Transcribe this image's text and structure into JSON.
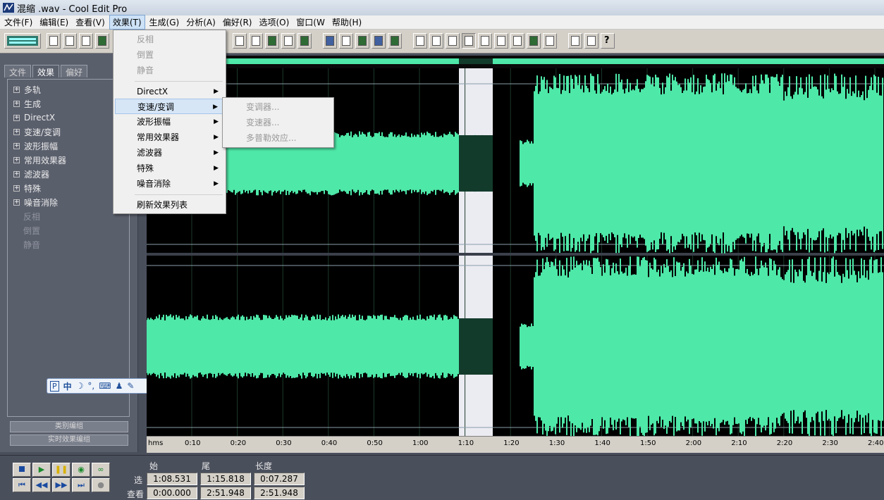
{
  "titlebar": {
    "title": "混缩  .wav - Cool Edit Pro"
  },
  "menubar": [
    "文件(F)",
    "编辑(E)",
    "查看(V)",
    "效果(T)",
    "生成(G)",
    "分析(A)",
    "偏好(R)",
    "选项(O)",
    "窗口(W",
    "帮助(H)"
  ],
  "left_panel": {
    "tabs": [
      "文件",
      "效果",
      "偏好"
    ],
    "tree_groups": [
      "多轨",
      "生成",
      "DirectX",
      "变速/变调",
      "波形振幅",
      "常用效果器",
      "滤波器",
      "特殊",
      "噪音消除"
    ],
    "tree_leaves": [
      "反相",
      "倒置",
      "静音"
    ],
    "buttons": [
      "类别编组",
      "实时效果编组"
    ]
  },
  "ime_toolbar": {
    "mode": "中",
    "brand": "P"
  },
  "effects_menu": {
    "items_top": [
      "反相",
      "倒置",
      "静音"
    ],
    "items_sub": [
      "DirectX",
      "变速/变调",
      "波形振幅",
      "常用效果器",
      "滤波器",
      "特殊",
      "噪音消除"
    ],
    "refresh": "刷新效果列表"
  },
  "submenu": [
    "变调器...",
    "变速器...",
    "多普勒效应..."
  ],
  "ruler": {
    "unit": "hms",
    "ticks": [
      "0:10",
      "0:20",
      "0:30",
      "0:40",
      "0:50",
      "1:00",
      "1:10",
      "1:20",
      "1:30",
      "1:40",
      "1:50",
      "2:00",
      "2:10",
      "2:20",
      "2:30",
      "2:40"
    ]
  },
  "selection": {
    "headers": {
      "begin": "始",
      "end": "尾",
      "length": "长度"
    },
    "rows": [
      {
        "label": "选",
        "begin": "1:08.531",
        "end": "1:15.818",
        "length": "0:07.287"
      },
      {
        "label": "查看",
        "begin": "0:00.000",
        "end": "2:51.948",
        "length": "2:51.948"
      }
    ]
  },
  "colors": {
    "wave": "#4ee8a8",
    "wave_selected": "#133b2b",
    "selection_bg": "#ebebf2",
    "background": "#000000"
  }
}
